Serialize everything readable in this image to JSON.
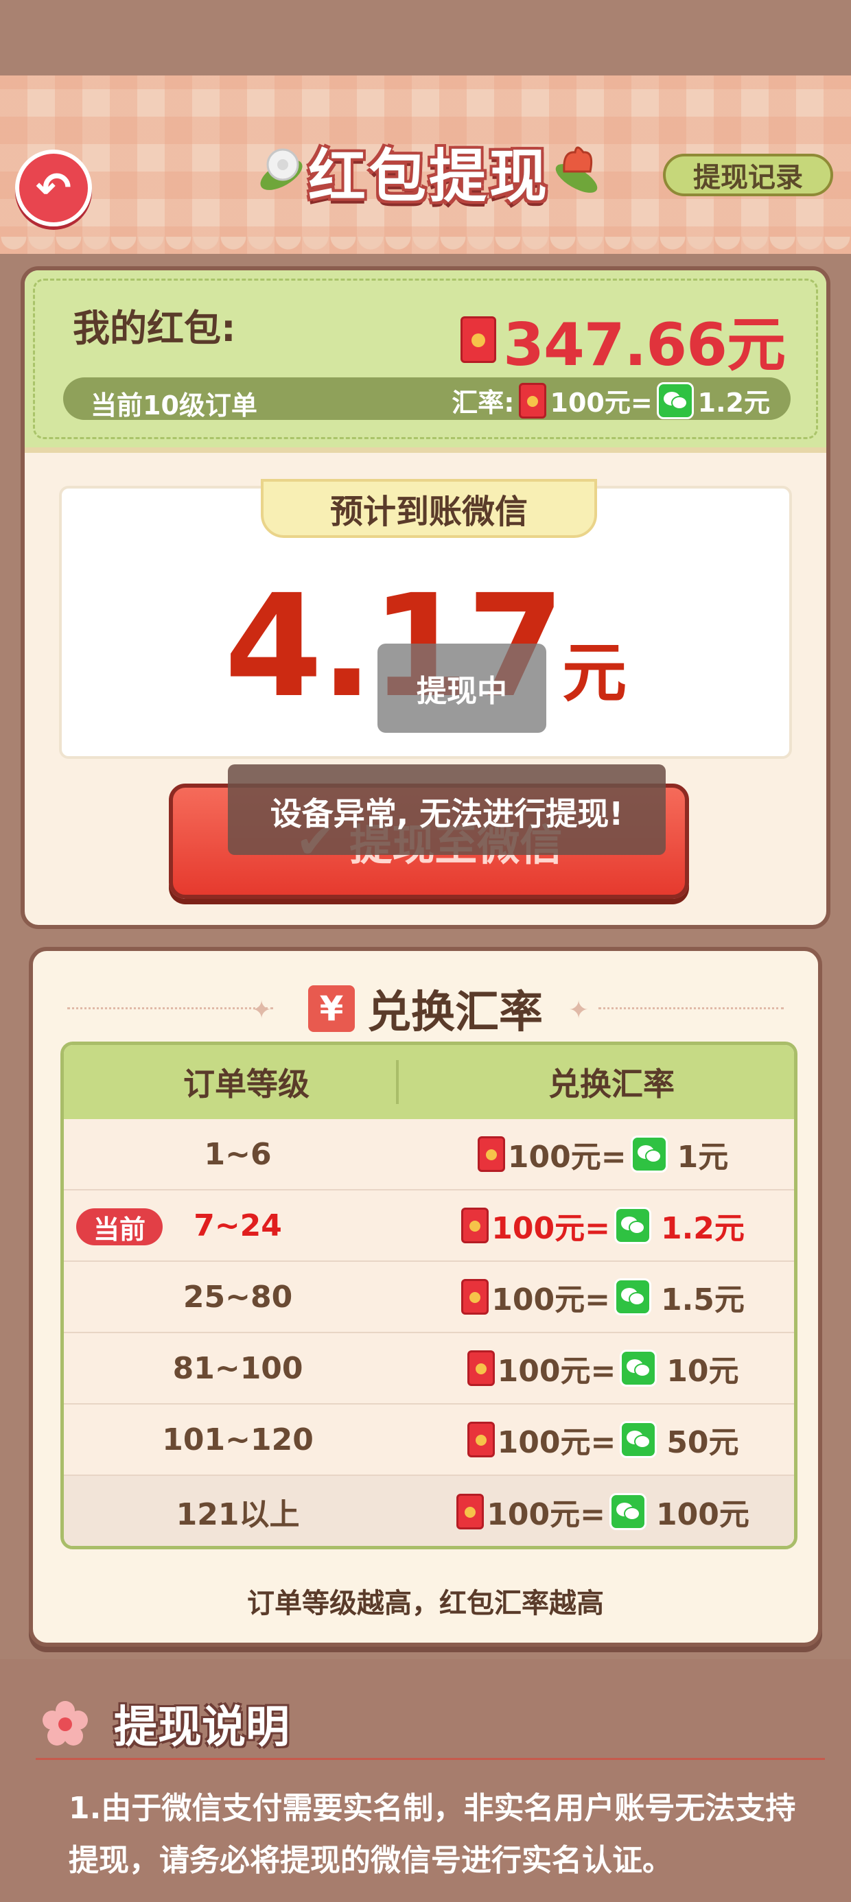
{
  "header": {
    "title": "红包提现",
    "back_icon": "back-arrow-icon",
    "record_button": "提现记录"
  },
  "wallet": {
    "label": "我的红包:",
    "amount": "347.66元",
    "level_text": "当前10级订单",
    "rate_label": "汇率:",
    "rate_from": "100元=",
    "rate_to": "1.2元"
  },
  "expected": {
    "label": "预计到账微信",
    "amount": "4.17",
    "unit": "元",
    "processing_toast": "提现中"
  },
  "withdraw_button": "提现至微信",
  "error_toast": "设备异常, 无法进行提现!",
  "rates": {
    "title": "兑换汇率",
    "header_level": "订单等级",
    "header_rate": "兑换汇率",
    "current_badge": "当前",
    "rows": [
      {
        "level": "1~6",
        "from": "100元=",
        "to": "1元",
        "current": false
      },
      {
        "level": "7~24",
        "from": "100元=",
        "to": "1.2元",
        "current": true
      },
      {
        "level": "25~80",
        "from": "100元=",
        "to": "1.5元",
        "current": false
      },
      {
        "level": "81~100",
        "from": "100元=",
        "to": "10元",
        "current": false
      },
      {
        "level": "101~120",
        "from": "100元=",
        "to": "50元",
        "current": false
      },
      {
        "level": "121以上",
        "from": "100元=",
        "to": "100元",
        "current": false
      }
    ],
    "footnote": "订单等级越高，红包汇率越高"
  },
  "notes": {
    "title": "提现说明",
    "text": "1.由于微信支付需要实名制，非实名用户账号无法支持提现，请务必将提现的微信号进行实名认证。"
  },
  "colors": {
    "accent_red": "#e0333c",
    "wechat_green": "#2fc242",
    "brown": "#8a5d4e",
    "green_panel": "#d4e6a0"
  }
}
